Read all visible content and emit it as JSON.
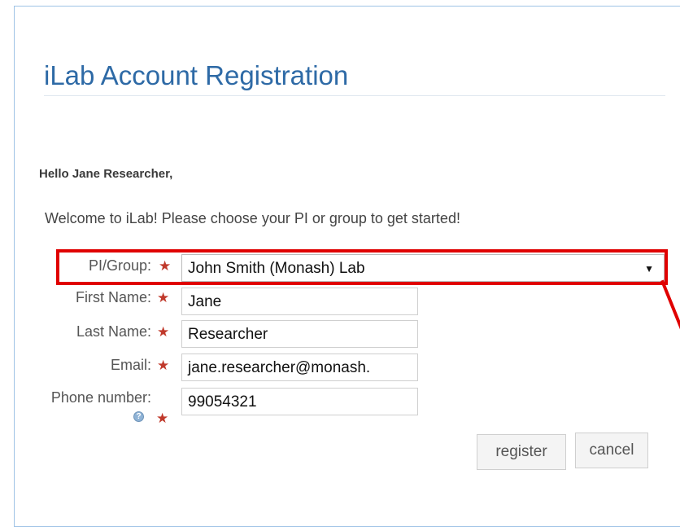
{
  "page": {
    "title": "iLab Account Registration",
    "greeting": "Hello Jane Researcher,",
    "welcome": "Welcome to iLab! Please choose your PI or group to get started!"
  },
  "form": {
    "pi_group": {
      "label": "PI/Group:",
      "value": "John Smith (Monash) Lab"
    },
    "first_name": {
      "label": "First Name:",
      "value": "Jane"
    },
    "last_name": {
      "label": "Last Name:",
      "value": "Researcher"
    },
    "email": {
      "label": "Email:",
      "value": "jane.researcher@monash."
    },
    "phone": {
      "label": "Phone number:",
      "value": "99054321"
    },
    "required_marker": "★",
    "dropdown_arrow": "▼",
    "help_glyph": "?"
  },
  "actions": {
    "register_label": "register",
    "cancel_label": "cancel"
  },
  "colors": {
    "title": "#2e6aa6",
    "required_star": "#c0392b",
    "highlight": "#e00000",
    "panel_border": "#9fc3e6"
  }
}
